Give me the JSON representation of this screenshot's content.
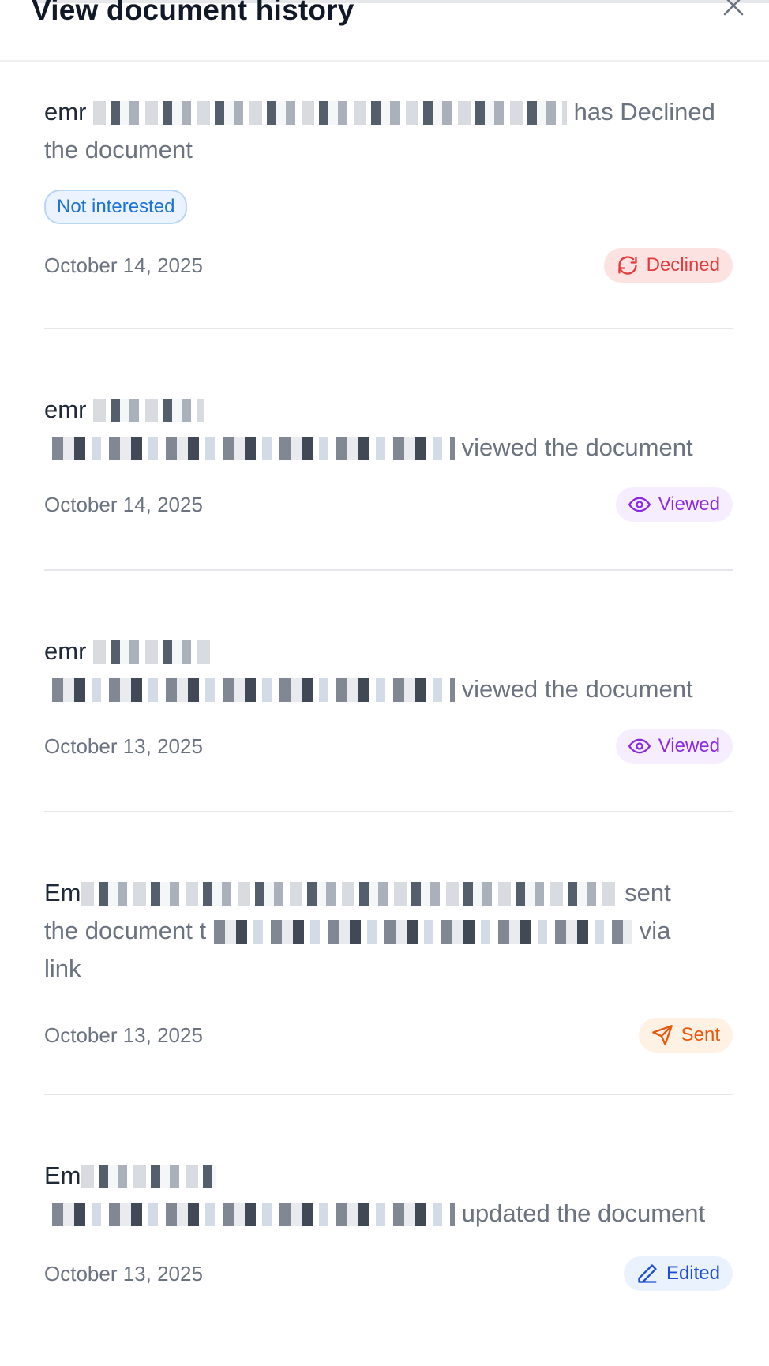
{
  "modal": {
    "title": "View document history",
    "close_icon": "close-icon"
  },
  "history": [
    {
      "actor": "emr",
      "action": "has Declined the document",
      "reason": "Not interested",
      "date": "October 14, 2025",
      "status": "Declined",
      "status_icon": "declined-refresh-icon",
      "status_color": "#e23b3b"
    },
    {
      "actor": "emr",
      "action": "viewed the document",
      "date": "October 14, 2025",
      "status": "Viewed",
      "status_icon": "eye-icon",
      "status_color": "#8a2be2"
    },
    {
      "actor": "emr",
      "action": "viewed the document",
      "date": "October 13, 2025",
      "status": "Viewed",
      "status_icon": "eye-icon",
      "status_color": "#8a2be2"
    },
    {
      "actor": "Em",
      "action_part1": "sent",
      "action_part2": "the document t",
      "action_part3": "via",
      "action_part4": "link",
      "date": "October 13, 2025",
      "status": "Sent",
      "status_icon": "send-icon",
      "status_color": "#ea580c"
    },
    {
      "actor": "Em",
      "action": "updated the document",
      "date": "October 13, 2025",
      "status": "Edited",
      "status_icon": "pencil-icon",
      "status_color": "#1d4ed8"
    }
  ]
}
